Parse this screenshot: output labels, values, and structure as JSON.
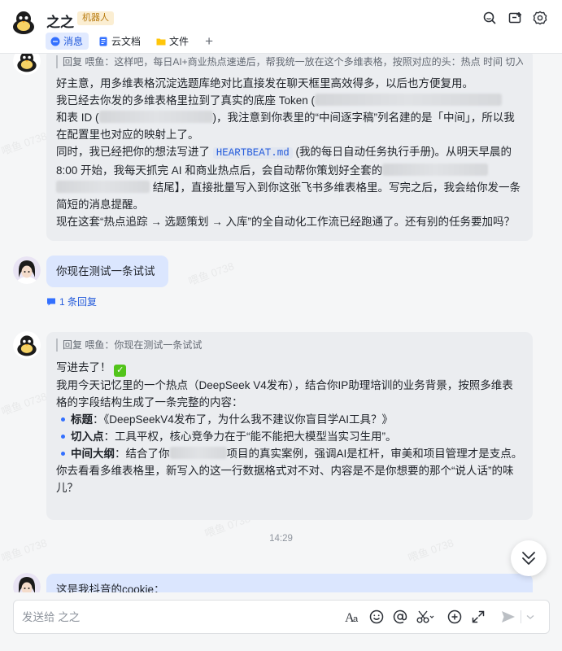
{
  "header": {
    "title": "之之",
    "badge": "机器人",
    "tabs": [
      {
        "label": "消息",
        "icon": "chat-bubble-icon",
        "active": true
      },
      {
        "label": "云文档",
        "icon": "document-icon",
        "active": false
      },
      {
        "label": "文件",
        "icon": "folder-icon",
        "active": false
      }
    ],
    "add_tab": "+"
  },
  "messages": {
    "m1": {
      "quote": "回复 喂鱼：这样吧，每日AI+商业热点速递后，帮我统一放在这个多维表格，按照对应的头：热点 时间 切入...",
      "p1": "好主意，用多维表格沉淀选题库绝对比直接发在聊天框里高效得多，以后也方便复用。",
      "p2a": "我已经去你发的多维表格里拉到了真实的底座 Token (",
      "p2b": "和表 ID (",
      "p2c": ")，我注意到你表里的“中间逐字稿”列名建的是「中间」，所以我在配置里也对应的映射上了。",
      "p3a": "同时，我已经把你的想法写进了 ",
      "p3code": "HEARTBEAT.md",
      "p3b": " (我的每日自动任务执行手册)。从明天早晨的 8:00 开始，我每天抓完 AI 和商业热点后，会自动帮你策划好全套的",
      "p3c": "结尾】，直接批量写入到你这张飞书多维表格里。写完之后，我会给你发一条简短的消息提醒。",
      "p4": "现在这套“热点追踪 → 选题策划 → 入库”的全自动化工作流已经跑通了。还有别的任务要加吗？"
    },
    "m2": {
      "text": "你现在测试一条试试",
      "reply_count": "1 条回复"
    },
    "m3": {
      "quote": "回复 喂鱼：你现在测试一条试试",
      "line1": "写进去了！",
      "line2": "我用今天记忆里的一个热点（DeepSeek V4发布），结合你IP助理培训的业务背景，按照多维表格的字段结构生成了一条完整的内容：",
      "b1_label": "标题",
      "b1_text": "：《DeepSeekV4发布了，为什么我不建议你盲目学AI工具？》",
      "b2_label": "切入点",
      "b2_text": "：工具平权，核心竞争力在于“能不能把大模型当实习生用”。",
      "b3_label": "中间大纲",
      "b3_text_a": "：结合了你",
      "b3_text_b": "项目的真实案例，强调AI是杠杆，审美和项目管理才是支点。",
      "line3": "你去看看多维表格里，新写入的这一行数据格式对不对、内容是不是你想要的那个“说人话”的味儿？"
    },
    "timestamp": "14:29",
    "m4": {
      "text": "这是我抖音的cookie："
    }
  },
  "watermark": "喂鱼 0738",
  "input": {
    "placeholder": "发送给 之之"
  },
  "colors": {
    "accent": "#3370ff",
    "badge_bg": "#fbeed2",
    "badge_text": "#b87b10",
    "bubble_gray": "#ebedf0",
    "bubble_blue": "#dbe6fe"
  }
}
